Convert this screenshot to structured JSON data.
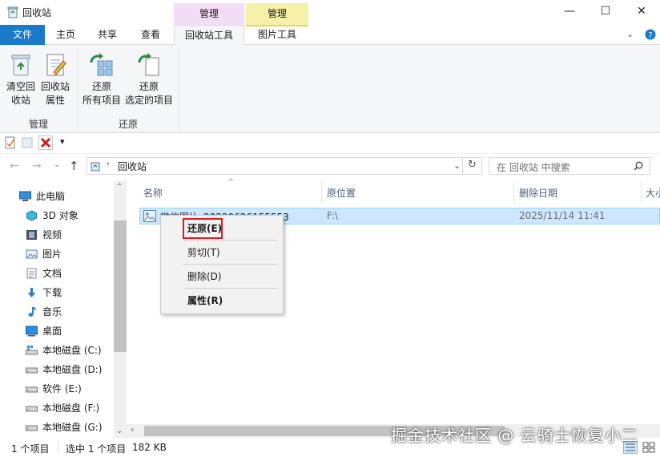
{
  "window": {
    "title": "回收站",
    "contextual_tabs": [
      "管理",
      "管理"
    ],
    "minimize": "—",
    "maximize": "☐",
    "close": "✕"
  },
  "tabs": {
    "file": "文件",
    "home": "主页",
    "share": "共享",
    "view": "查看",
    "recycle_tools": "回收站工具",
    "picture_tools": "图片工具"
  },
  "ribbon": {
    "empty_recycle_1": "清空回",
    "empty_recycle_2": "收站",
    "recycle_props_1": "回收站",
    "recycle_props_2": "属性",
    "restore_all_1": "还原",
    "restore_all_2": "所有项目",
    "restore_selected_1": "还原",
    "restore_selected_2": "选定的项目",
    "group_manage": "管理",
    "group_restore": "还原"
  },
  "qat": {
    "dropdown": "▾"
  },
  "address": {
    "path": "回收站",
    "search_placeholder": "在 回收站 中搜索"
  },
  "nav": {
    "items": [
      {
        "label": "此电脑",
        "icon": "computer-icon"
      },
      {
        "label": "3D 对象",
        "icon": "3d-objects-icon"
      },
      {
        "label": "视频",
        "icon": "video-icon"
      },
      {
        "label": "图片",
        "icon": "pictures-icon"
      },
      {
        "label": "文档",
        "icon": "documents-icon"
      },
      {
        "label": "下载",
        "icon": "download-icon"
      },
      {
        "label": "音乐",
        "icon": "music-icon"
      },
      {
        "label": "桌面",
        "icon": "desktop-icon"
      },
      {
        "label": "本地磁盘 (C:)",
        "icon": "drive-c-icon"
      },
      {
        "label": "本地磁盘 (D:)",
        "icon": "drive-icon"
      },
      {
        "label": "软件 (E:)",
        "icon": "drive-icon"
      },
      {
        "label": "本地磁盘 (F:)",
        "icon": "drive-icon"
      },
      {
        "label": "本地磁盘 (G:)",
        "icon": "drive-icon"
      }
    ]
  },
  "list": {
    "columns": [
      "名称",
      "原位置",
      "删除日期",
      "大小"
    ],
    "rows": [
      {
        "name": "微信图片_20220626155553",
        "location": "F:\\",
        "deleted": "2025/11/14 11:41"
      }
    ]
  },
  "context_menu": {
    "restore": "还原(E)",
    "cut": "剪切(T)",
    "delete": "删除(D)",
    "properties": "属性(R)"
  },
  "status": {
    "item_count": "1 个项目",
    "selected": "选中 1 个项目",
    "size": "182 KB"
  },
  "watermark": "掘金技术社区 @ 云骑士恢复小二",
  "colors": {
    "accent": "#1979ca",
    "selection": "#cce8ff",
    "context_manage_1": "#f3ddf6",
    "context_manage_2": "#f6f0a8",
    "highlight_box": "#e0191c"
  }
}
